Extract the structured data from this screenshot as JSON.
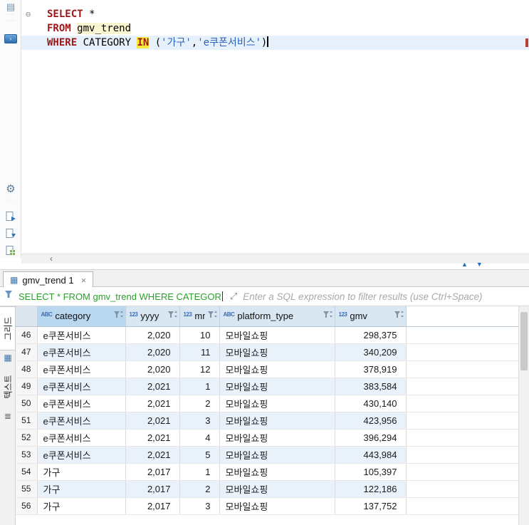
{
  "colors": {
    "keyword": "#9b1717",
    "string": "#2a62bd",
    "occurrence_highlight": "#f5e93b",
    "current_line": "#e7f1fb",
    "filter_query_green": "#28a228",
    "header_selected": "#b9d7ef",
    "row_stripe": "#e9f2fb"
  },
  "icons": {
    "fold_collapse": "⊖",
    "scroll_left": "‹",
    "panel": "▤",
    "gear": "⚙",
    "console_glyph": "›",
    "grid_glyph": "▦",
    "text_glyph": "≣",
    "expand_glyph": "⤢",
    "restore_up": "▲",
    "restore_down": "▼"
  },
  "editor": {
    "lines": [
      {
        "fold": true,
        "tokens": [
          {
            "t": "SELECT",
            "c": "kw"
          },
          {
            "t": " *",
            "c": "pl"
          }
        ]
      },
      {
        "tokens": [
          {
            "t": "FROM",
            "c": "kw"
          },
          {
            "t": " ",
            "c": "pl"
          },
          {
            "t": "gmv_trend",
            "c": "ident"
          }
        ]
      },
      {
        "current": true,
        "cursor": true,
        "tokens": [
          {
            "t": "WHERE",
            "c": "kw"
          },
          {
            "t": " CATEGORY ",
            "c": "pl"
          },
          {
            "t": "IN",
            "c": "kwhl"
          },
          {
            "t": " (",
            "c": "pl"
          },
          {
            "t": "'가구'",
            "c": "str"
          },
          {
            "t": ",",
            "c": "pl"
          },
          {
            "t": "'e쿠폰서비스'",
            "c": "str"
          },
          {
            "t": ")",
            "c": "pl"
          }
        ]
      }
    ]
  },
  "results": {
    "tab": {
      "label": "gmv_trend 1",
      "close": "×"
    },
    "filter": {
      "query": "SELECT * FROM gmv_trend WHERE CATEGOR",
      "placeholder": "Enter a SQL expression to filter results (use Ctrl+Space)"
    },
    "side_tabs": [
      {
        "label": "그리드"
      },
      {
        "label": "텍스트"
      }
    ],
    "grid": {
      "columns": [
        {
          "type": "ABC",
          "label": "category",
          "selected": true
        },
        {
          "type": "123",
          "label": "yyyy"
        },
        {
          "type": "123",
          "label": "mm"
        },
        {
          "type": "ABC",
          "label": "platform_type"
        },
        {
          "type": "123",
          "label": "gmv"
        }
      ],
      "rows": [
        {
          "num": "46",
          "category": "e쿠폰서비스",
          "yyyy": "2,020",
          "mm": "10",
          "platform_type": "모바일쇼핑",
          "gmv": "298,375"
        },
        {
          "num": "47",
          "category": "e쿠폰서비스",
          "yyyy": "2,020",
          "mm": "11",
          "platform_type": "모바일쇼핑",
          "gmv": "340,209"
        },
        {
          "num": "48",
          "category": "e쿠폰서비스",
          "yyyy": "2,020",
          "mm": "12",
          "platform_type": "모바일쇼핑",
          "gmv": "378,919"
        },
        {
          "num": "49",
          "category": "e쿠폰서비스",
          "yyyy": "2,021",
          "mm": "1",
          "platform_type": "모바일쇼핑",
          "gmv": "383,584"
        },
        {
          "num": "50",
          "category": "e쿠폰서비스",
          "yyyy": "2,021",
          "mm": "2",
          "platform_type": "모바일쇼핑",
          "gmv": "430,140"
        },
        {
          "num": "51",
          "category": "e쿠폰서비스",
          "yyyy": "2,021",
          "mm": "3",
          "platform_type": "모바일쇼핑",
          "gmv": "423,956"
        },
        {
          "num": "52",
          "category": "e쿠폰서비스",
          "yyyy": "2,021",
          "mm": "4",
          "platform_type": "모바일쇼핑",
          "gmv": "396,294"
        },
        {
          "num": "53",
          "category": "e쿠폰서비스",
          "yyyy": "2,021",
          "mm": "5",
          "platform_type": "모바일쇼핑",
          "gmv": "443,984"
        },
        {
          "num": "54",
          "category": "가구",
          "yyyy": "2,017",
          "mm": "1",
          "platform_type": "모바일쇼핑",
          "gmv": "105,397"
        },
        {
          "num": "55",
          "category": "가구",
          "yyyy": "2,017",
          "mm": "2",
          "platform_type": "모바일쇼핑",
          "gmv": "122,186"
        },
        {
          "num": "56",
          "category": "가구",
          "yyyy": "2,017",
          "mm": "3",
          "platform_type": "모바일쇼핑",
          "gmv": "137,752"
        }
      ]
    }
  }
}
